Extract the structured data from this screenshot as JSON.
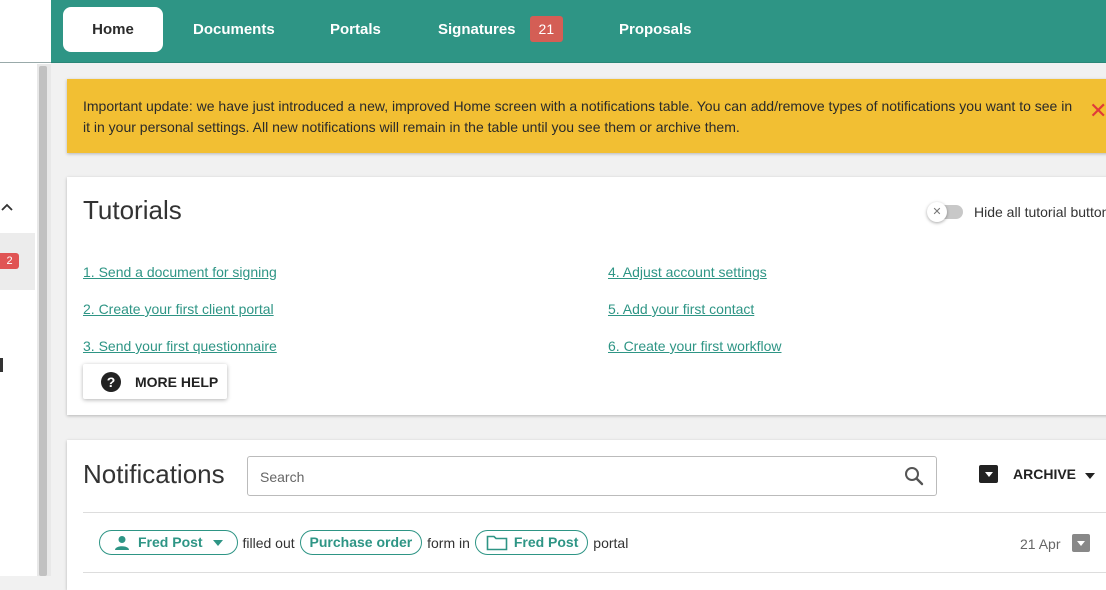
{
  "sidebar": {
    "badge": "2"
  },
  "nav": {
    "tabs": [
      {
        "label": "Home"
      },
      {
        "label": "Documents"
      },
      {
        "label": "Portals"
      },
      {
        "label": "Signatures",
        "count": "21"
      },
      {
        "label": "Proposals"
      }
    ]
  },
  "alert": {
    "message": "Important update: we have just introduced a new, improved Home screen with a notifications table. You can add/remove types of notifications you want to see in it in your personal settings. All new notifications will remain in the table until you see them or archive them.",
    "close_glyph": "✕"
  },
  "tutorials": {
    "title": "Tutorials",
    "toggle_label": "Hide all tutorial buttons",
    "links": [
      "1. Send a document for signing",
      "2. Create your first client portal",
      "3. Send your first questionnaire",
      "4. Adjust account settings",
      "5. Add your first contact",
      "6. Create your first workflow"
    ],
    "more_help": "MORE HELP"
  },
  "notifications": {
    "title": "Notifications",
    "search_placeholder": "Search",
    "archive_label": "ARCHIVE",
    "rows": [
      {
        "user": "Fred Post",
        "text1": "filled out",
        "form": "Purchase order",
        "text2": "form in",
        "portal": "Fred Post",
        "text3": "portal",
        "date": "21 Apr"
      }
    ]
  },
  "colors": {
    "brand": "#2e9585",
    "alert": "#f2bf33",
    "badge": "#d45e55"
  }
}
